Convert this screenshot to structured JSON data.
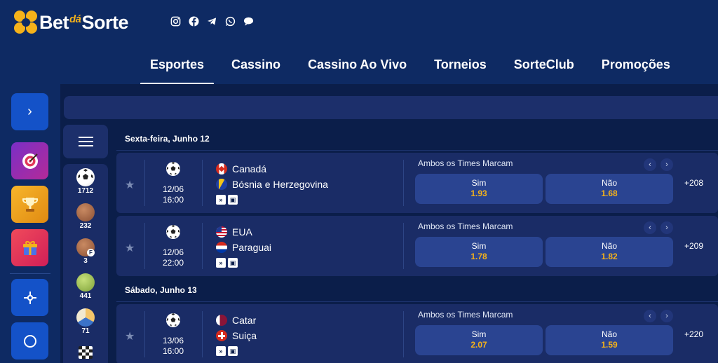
{
  "brand": {
    "part1": "Bet",
    "part2": "dá",
    "part3": "Sorte"
  },
  "socials": [
    "instagram-icon",
    "facebook-icon",
    "telegram-icon",
    "whatsapp-icon",
    "chat-icon"
  ],
  "nav": {
    "items": [
      {
        "label": "Esportes",
        "active": true
      },
      {
        "label": "Cassino"
      },
      {
        "label": "Cassino Ao Vivo"
      },
      {
        "label": "Torneios"
      },
      {
        "label": "SorteClub"
      },
      {
        "label": "Promoções"
      }
    ]
  },
  "sports": [
    {
      "icon": "soccer-ball-icon",
      "count": "1712"
    },
    {
      "icon": "basketball-icon",
      "count": "232"
    },
    {
      "icon": "basketball-f-icon",
      "count": "3"
    },
    {
      "icon": "tennis-ball-icon",
      "count": "441"
    },
    {
      "icon": "volleyball-icon",
      "count": "71"
    },
    {
      "icon": "racing-flag-icon",
      "count": ""
    }
  ],
  "days": [
    {
      "label": "Sexta-feira,  Junho 12"
    },
    {
      "label": "Sábado,  Junho 13"
    }
  ],
  "matches": [
    {
      "date": "12/06",
      "time": "16:00",
      "home": "Canadá",
      "away": "Bósnia e Herzegovina",
      "market": "Ambos os Times Marcam",
      "yes_label": "Sim",
      "yes_odd": "1.93",
      "no_label": "Não",
      "no_odd": "1.68",
      "more": "+208"
    },
    {
      "date": "12/06",
      "time": "22:00",
      "home": "EUA",
      "away": "Paraguai",
      "market": "Ambos os Times Marcam",
      "yes_label": "Sim",
      "yes_odd": "1.78",
      "no_label": "Não",
      "no_odd": "1.82",
      "more": "+209"
    },
    {
      "date": "13/06",
      "time": "16:00",
      "home": "Catar",
      "away": "Suiça",
      "market": "Ambos os Times Marcam",
      "yes_label": "Sim",
      "yes_odd": "2.07",
      "no_label": "Não",
      "no_odd": "1.59",
      "more": "+220"
    }
  ],
  "colors": {
    "accent": "#f5b21a",
    "background": "#0e2a63",
    "panel": "#1a2c66"
  }
}
